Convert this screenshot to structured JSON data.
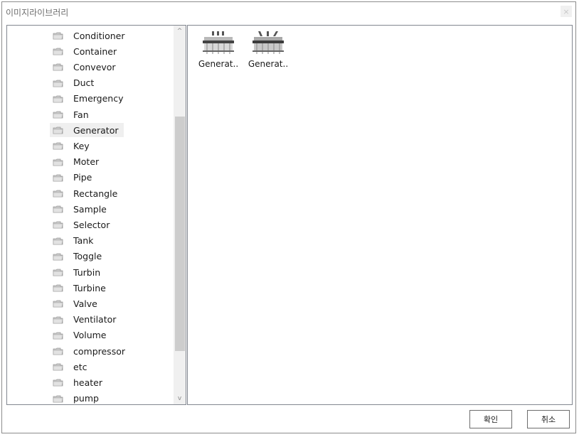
{
  "window": {
    "title": "이미지라이브러리",
    "close_symbol": "×"
  },
  "tree": {
    "items": [
      {
        "label": "Conditioner",
        "selected": false
      },
      {
        "label": "Container",
        "selected": false
      },
      {
        "label": "Convevor",
        "selected": false
      },
      {
        "label": "Duct",
        "selected": false
      },
      {
        "label": "Emergency",
        "selected": false
      },
      {
        "label": "Fan",
        "selected": false
      },
      {
        "label": "Generator",
        "selected": true
      },
      {
        "label": "Key",
        "selected": false
      },
      {
        "label": "Moter",
        "selected": false
      },
      {
        "label": "Pipe",
        "selected": false
      },
      {
        "label": "Rectangle",
        "selected": false
      },
      {
        "label": "Sample",
        "selected": false
      },
      {
        "label": "Selector",
        "selected": false
      },
      {
        "label": "Tank",
        "selected": false
      },
      {
        "label": "Toggle",
        "selected": false
      },
      {
        "label": "Turbin",
        "selected": false
      },
      {
        "label": "Turbine",
        "selected": false
      },
      {
        "label": "Valve",
        "selected": false
      },
      {
        "label": "Ventilator",
        "selected": false
      },
      {
        "label": "Volume",
        "selected": false
      },
      {
        "label": "compressor",
        "selected": false
      },
      {
        "label": "etc",
        "selected": false
      },
      {
        "label": "heater",
        "selected": false
      },
      {
        "label": "pump",
        "selected": false
      }
    ],
    "folder_icon": "folder-icon",
    "scroll_up_symbol": "^",
    "scroll_down_symbol": "v"
  },
  "preview": {
    "thumbnails": [
      {
        "label": "Generat..",
        "icon": "generator-1-icon"
      },
      {
        "label": "Generat..",
        "icon": "generator-2-icon"
      }
    ]
  },
  "buttons": {
    "ok_label": "확인",
    "cancel_label": "취소"
  },
  "colors": {
    "selected_row": "#efefef",
    "border": "#828790",
    "scroll_thumb": "#cdcdcd"
  }
}
